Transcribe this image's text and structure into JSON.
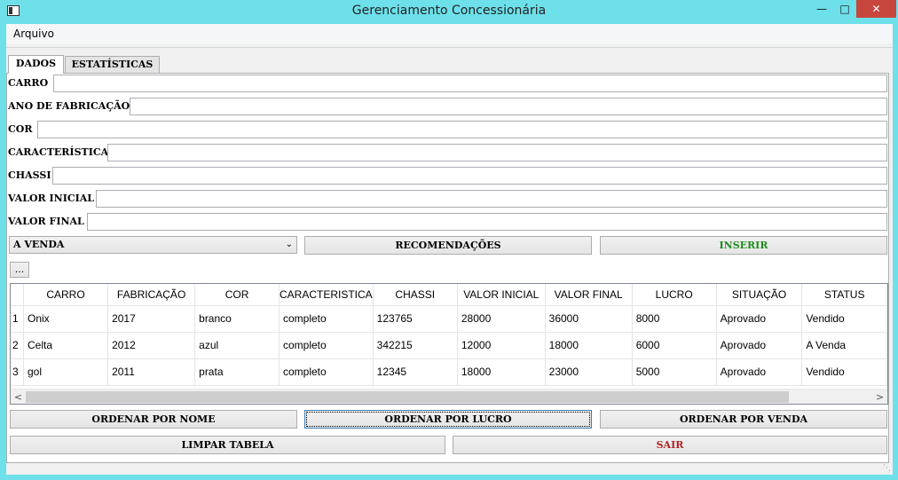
{
  "window": {
    "title": "Gerenciamento Concessionária"
  },
  "menu": {
    "arquivo": "Arquivo"
  },
  "tabs": {
    "dados": "DADOS",
    "estatisticas": "ESTATÍSTICAS"
  },
  "form": {
    "carro_label": "CARRO",
    "ano_label": "ANO DE FABRICAÇÃO",
    "cor_label": "COR",
    "caracteristica_label": "CARACTERÍSTICA",
    "chassi_label": "CHASSI",
    "valor_inicial_label": "VALOR INICIAL",
    "valor_final_label": "VALOR FINAL",
    "status_select": "A VENDA"
  },
  "buttons": {
    "recomendacoes": "RECOMENDAÇÕES",
    "inserir": "INSERIR",
    "ellipsis": "...",
    "ordenar_nome": "ORDENAR POR NOME",
    "ordenar_lucro": "ORDENAR POR LUCRO",
    "ordenar_venda": "ORDENAR POR VENDA",
    "limpar": "LIMPAR TABELA",
    "sair": "SAIR"
  },
  "colors": {
    "inserir": "#1e8c1e",
    "sair": "#b22222",
    "titlebar": "#6de0ea",
    "close": "#c7463d"
  },
  "table": {
    "headers": [
      "CARRO",
      "FABRICAÇÃO",
      "COR",
      "CARACTERISTICA",
      "CHASSI",
      "VALOR INICIAL",
      "VALOR FINAL",
      "LUCRO",
      "SITUAÇÃO",
      "STATUS"
    ],
    "rows": [
      {
        "num": "1",
        "cells": [
          "Onix",
          "2017",
          "branco",
          "completo",
          "123765",
          "28000",
          "36000",
          "8000",
          "Aprovado",
          "Vendido"
        ]
      },
      {
        "num": "2",
        "cells": [
          "Celta",
          "2012",
          "azul",
          "completo",
          "342215",
          "12000",
          "18000",
          "6000",
          "Aprovado",
          "A Venda"
        ]
      },
      {
        "num": "3",
        "cells": [
          "gol",
          "2011",
          "prata",
          "completo",
          "12345",
          "18000",
          "23000",
          "5000",
          "Aprovado",
          "Vendido"
        ]
      }
    ]
  }
}
